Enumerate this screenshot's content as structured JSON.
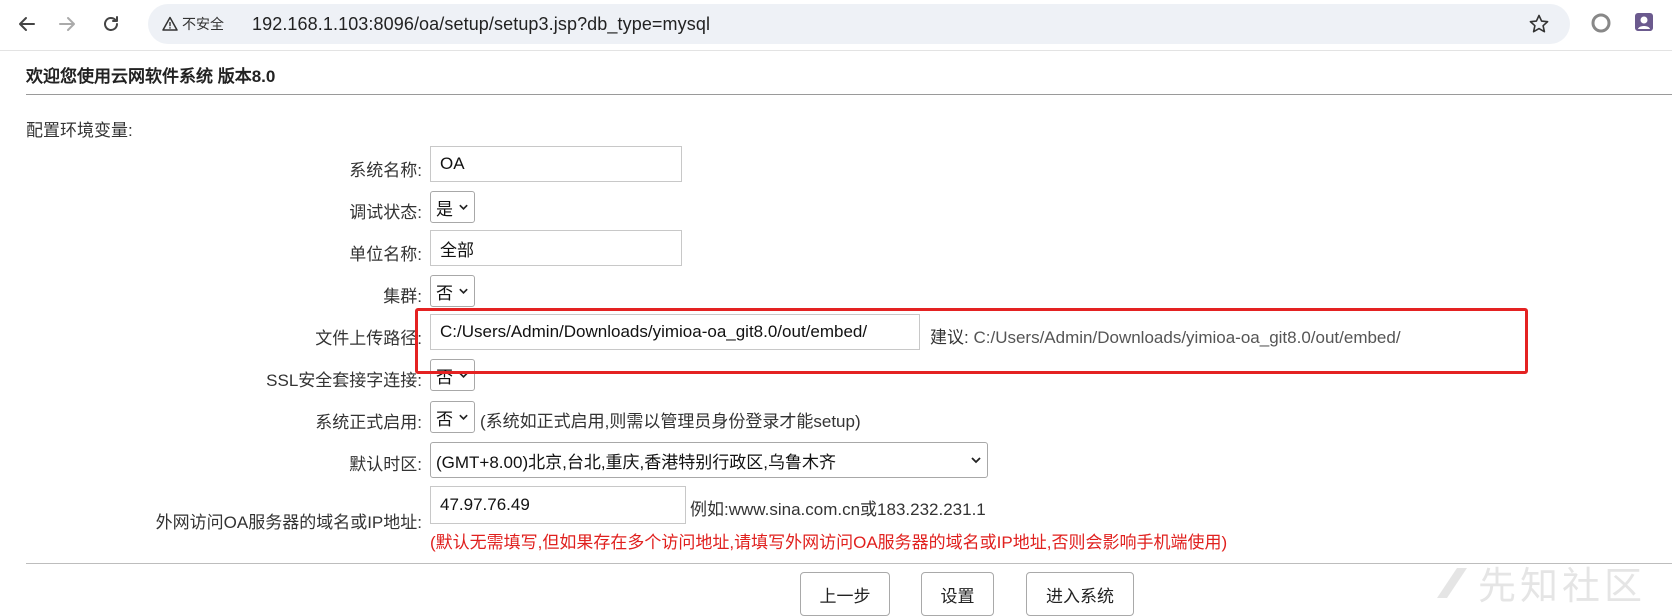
{
  "browser": {
    "security_label": "不安全",
    "url": "192.168.1.103:8096/oa/setup/setup3.jsp?db_type=mysql",
    "icons": {
      "back": "arrow-left-icon",
      "forward": "arrow-right-icon",
      "reload": "reload-icon",
      "warning": "warning-triangle-icon",
      "bookmark": "star-icon",
      "extension1": "circle-extension-icon",
      "extension2": "profile-extension-icon"
    }
  },
  "page": {
    "welcome": "欢迎您使用云网软件系统 版本8.0",
    "config_title": "配置环境变量:"
  },
  "form": {
    "system_name": {
      "label": "系统名称:",
      "value": "OA"
    },
    "debug_state": {
      "label": "调试状态:",
      "value": "是"
    },
    "unit_name": {
      "label": "单位名称:",
      "value": "全部"
    },
    "cluster": {
      "label": "集群:",
      "value": "否"
    },
    "upload_path": {
      "label": "文件上传路径:",
      "value": "C:/Users/Admin/Downloads/yimioa-oa_git8.0/out/embed/",
      "suggest_label": "建议:",
      "suggest_value": "C:/Users/Admin/Downloads/yimioa-oa_git8.0/out/embed/"
    },
    "ssl": {
      "label": "SSL安全套接字连接:",
      "value": "否"
    },
    "official_use": {
      "label": "系统正式启用:",
      "value": "否",
      "note": "(系统如正式启用,则需以管理员身份登录才能setup)"
    },
    "timezone": {
      "label": "默认时区:",
      "value": "(GMT+8.00)北京,台北,重庆,香港特别行政区,乌鲁木齐"
    },
    "external_domain": {
      "label": "外网访问OA服务器的域名或IP地址:",
      "value": "47.97.76.49",
      "example": "例如:www.sina.com.cn或183.232.231.1",
      "note": "(默认无需填写,但如果存在多个访问地址,请填写外网访问OA服务器的域名或IP地址,否则会影响手机端使用)"
    }
  },
  "buttons": {
    "prev": "上一步",
    "set": "设置",
    "enter": "进入系统"
  },
  "watermark": "先知社区",
  "colors": {
    "highlight_border": "#e42222",
    "note_red": "#e0201e",
    "omnibox_bg": "#eef1f6"
  }
}
